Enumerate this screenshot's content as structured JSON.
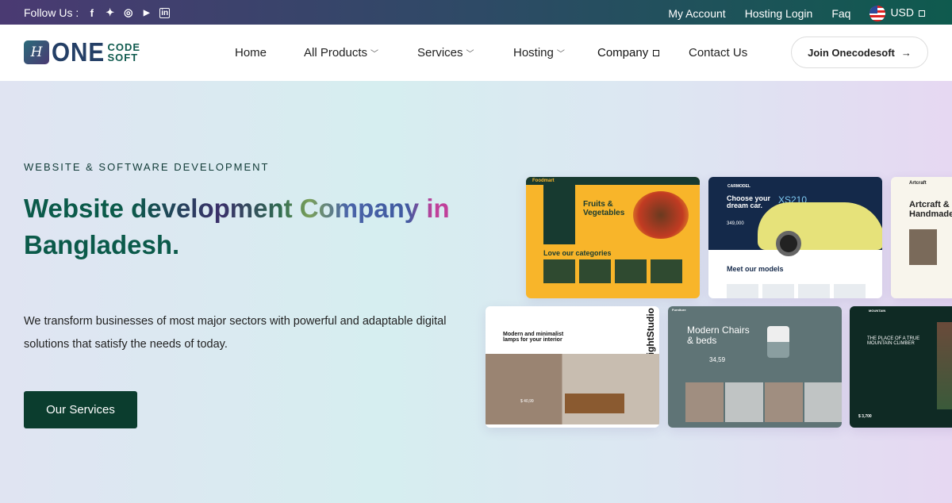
{
  "topbar": {
    "follow_label": "Follow Us :",
    "social": [
      {
        "icon": "facebook-icon",
        "glyph": "f"
      },
      {
        "icon": "twitter-icon",
        "glyph": "🐦"
      },
      {
        "icon": "instagram-icon",
        "glyph": "◎"
      },
      {
        "icon": "youtube-icon",
        "glyph": "▶"
      },
      {
        "icon": "linkedin-icon",
        "glyph": "in"
      }
    ],
    "links": [
      "My Account",
      "Hosting Login",
      "Faq"
    ],
    "currency": "USD"
  },
  "nav": {
    "logo": {
      "mark": "H",
      "one": "ONE",
      "code": "CODE",
      "soft": "SOFT"
    },
    "items": [
      {
        "label": "Home"
      },
      {
        "label": "All Products"
      },
      {
        "label": "Services"
      },
      {
        "label": "Hosting"
      },
      {
        "label": "Company"
      },
      {
        "label": "Contact Us"
      }
    ],
    "join_label": "Join Onecodesoft"
  },
  "hero": {
    "kicker": "WEBSITE & SOFTWARE DEVELOPMENT",
    "title_line1": "Website development Company in",
    "title_line2": "Bangladesh.",
    "description": "We transform businesses of most major sectors with powerful and adaptable digital solutions that satisfy the needs of today.",
    "cta_label": "Our Services"
  },
  "showcase": [
    {
      "brand": "Foodmart",
      "title": "Fruits & Vegetables",
      "sub": "Love our categories"
    },
    {
      "brand": "CARMODEL",
      "title": "Choose your dream car.",
      "model": "XS210",
      "price": "349,000",
      "sub": "Meet our models"
    },
    {
      "brand": "Artcraft",
      "title": "Artcraft & Handmade"
    },
    {
      "brand": "LightStudio",
      "title": "Modern and minimalist lamps for your interior",
      "price": "$ 40,99"
    },
    {
      "brand": "Furniture",
      "title": "Modern Chairs & beds",
      "price": "34,59"
    },
    {
      "brand": "MOUNTAIN",
      "title": "THE PLACE OF A TRUE MOUNTAIN CLIMBER",
      "price": "$ 3,700"
    }
  ],
  "colors": {
    "accent": "#0b5a4a",
    "cta": "#0b3d2e",
    "food": "#f8b52a",
    "car": "#14294a",
    "furniture": "#5f7476",
    "mountain": "#0f2a24"
  }
}
